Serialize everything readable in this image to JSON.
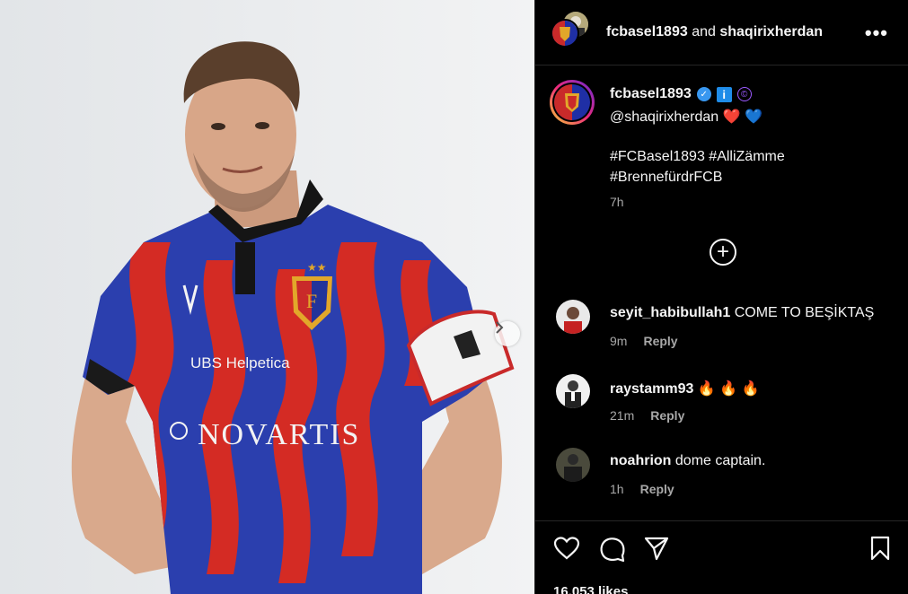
{
  "header": {
    "account1": "fcbasel1893",
    "connector": "and",
    "account2": "shaqirixherdan",
    "more_icon": "more-horizontal-icon"
  },
  "caption": {
    "username": "fcbasel1893",
    "badges": [
      "verified-icon",
      "info-icon",
      "copyright-icon"
    ],
    "mention": "@shaqirixherdan",
    "emojis": [
      "❤️",
      "💙"
    ],
    "hashtags_line1": "#FCBasel1893 #AlliZämme",
    "hashtags_line2": "#BrennefürdrFCB",
    "time": "7h"
  },
  "comments": [
    {
      "username": "seyit_habibullah1",
      "text": "COME TO BEŞİKTAŞ",
      "time": "9m",
      "reply": "Reply"
    },
    {
      "username": "raystamm93",
      "text": "🔥 🔥 🔥",
      "time": "21m",
      "reply": "Reply"
    },
    {
      "username": "noahrion",
      "text": "dome captain.",
      "time": "1h",
      "reply": "Reply"
    }
  ],
  "actions": {
    "like_icon": "heart-icon",
    "comment_icon": "comment-icon",
    "share_icon": "send-icon",
    "save_icon": "bookmark-icon"
  },
  "likes_text": "16,053 likes",
  "media": {
    "sponsor1": "UBS Helpetica",
    "sponsor2": "NOVARTIS"
  },
  "colors": {
    "background": "#000000",
    "secondary_text": "#a8a8a8",
    "verified": "#3897f0",
    "kit_blue": "#2b3fae",
    "kit_red": "#d42b24"
  }
}
